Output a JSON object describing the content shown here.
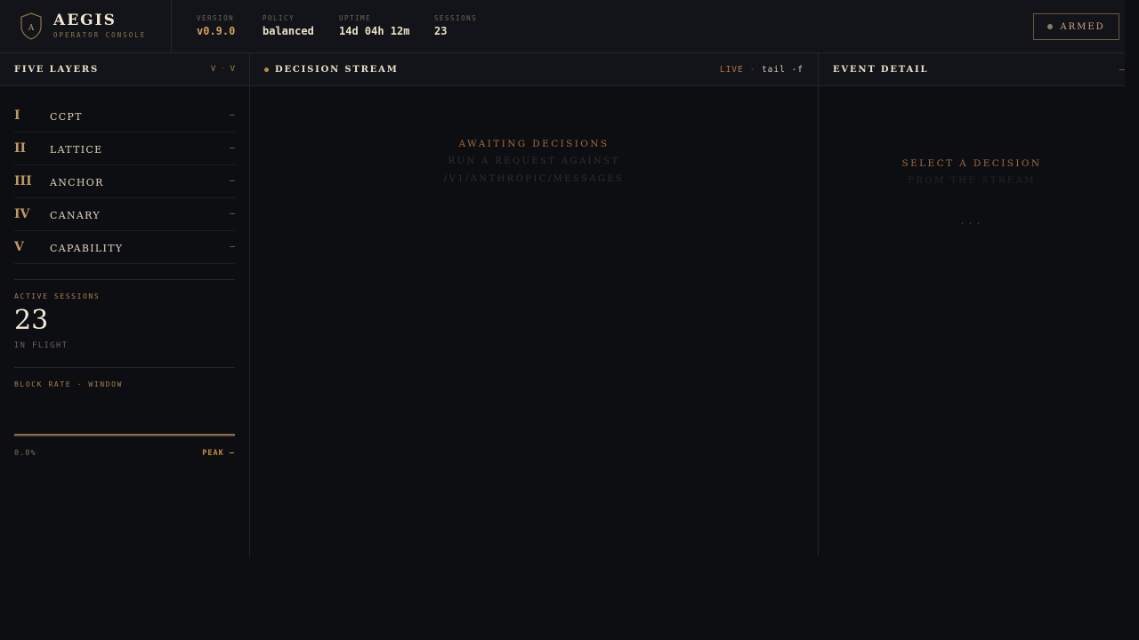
{
  "header": {
    "brand_initial": "A",
    "brand_name": "AEGIS",
    "brand_sub": "OPERATOR CONSOLE",
    "stats": [
      {
        "label": "VERSION",
        "value": "v0.9.0"
      },
      {
        "label": "POLICY",
        "value": "balanced"
      },
      {
        "label": "UPTIME",
        "value": "14d 04h 12m"
      },
      {
        "label": "SESSIONS",
        "value": "23"
      }
    ],
    "armed_label": "ARMED"
  },
  "layers_panel": {
    "title": "FIVE LAYERS",
    "nav_hint_left": "V",
    "nav_hint_sep": "·",
    "nav_hint_right": "V",
    "layers": [
      {
        "numeral": "I",
        "name": "CCPT",
        "value": "–"
      },
      {
        "numeral": "II",
        "name": "LATTICE",
        "value": "–"
      },
      {
        "numeral": "III",
        "name": "ANCHOR",
        "value": "–"
      },
      {
        "numeral": "IV",
        "name": "CANARY",
        "value": "–"
      },
      {
        "numeral": "V",
        "name": "CAPABILITY",
        "value": "–"
      }
    ],
    "active_sessions_label": "ACTIVE SESSIONS",
    "active_sessions_value": "23",
    "in_flight_label": "IN FLIGHT",
    "block_rate_label": "BLOCK RATE · WINDOW",
    "block_rate_value": "0.0%",
    "peak_label": "PEAK –"
  },
  "stream_panel": {
    "title": "DECISION STREAM",
    "live_label": "LIVE",
    "sep": "·",
    "tail_label": "tail -f",
    "empty_title": "AWAITING DECISIONS",
    "empty_line1": "RUN A REQUEST AGAINST",
    "empty_line2": "/V1/ANTHROPIC/MESSAGES"
  },
  "detail_panel": {
    "title": "EVENT DETAIL",
    "dash": "–",
    "empty_title": "SELECT A DECISION",
    "empty_line1": "FROM THE STREAM",
    "ellipsis": "..."
  },
  "colors": {
    "background": "#0d0e12",
    "panel": "#131419",
    "accent": "#c98a3e",
    "text": "#eadfc6"
  }
}
